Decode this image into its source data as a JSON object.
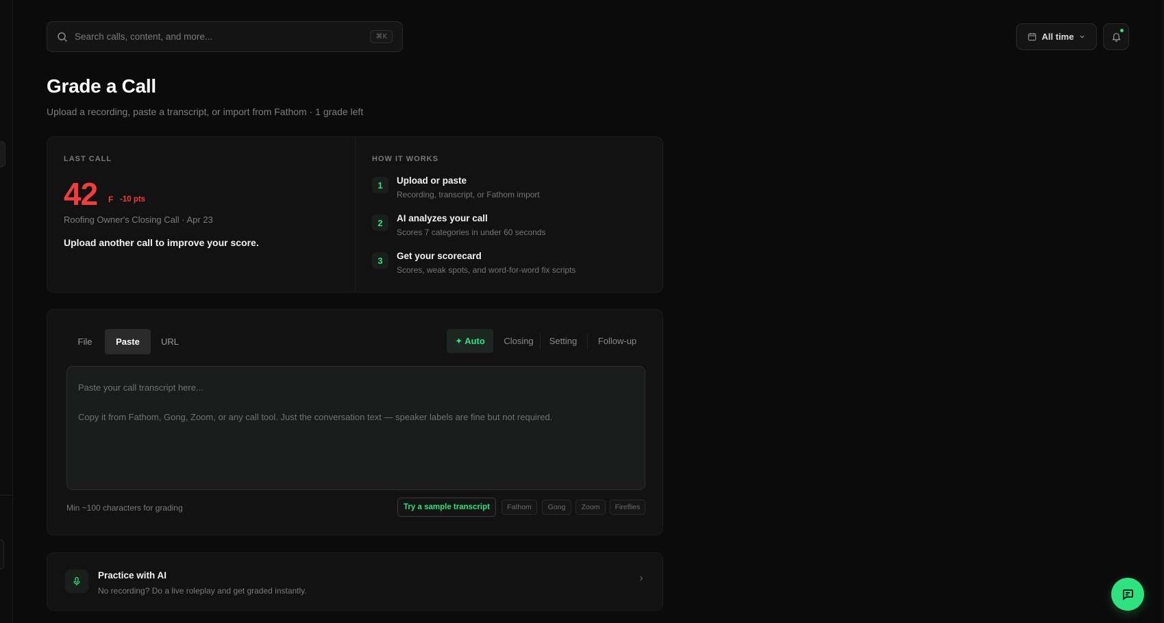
{
  "search": {
    "placeholder": "Search calls, content, and more...",
    "shortcut": "⌘K"
  },
  "header": {
    "time_filter": "All time"
  },
  "page": {
    "title": "Grade a Call",
    "subtitle": "Upload a recording, paste a transcript, or import from Fathom · 1 grade left"
  },
  "last_call": {
    "label": "LAST CALL",
    "score": "42",
    "grade": "F",
    "delta": "-10 pts",
    "meta": "Roofing Owner's Closing Call · Apr 23",
    "cta": "Upload another call to improve your score."
  },
  "how_it_works": {
    "label": "HOW IT WORKS",
    "steps": [
      {
        "num": "1",
        "title": "Upload or paste",
        "desc": "Recording, transcript, or Fathom import"
      },
      {
        "num": "2",
        "title": "AI analyzes your call",
        "desc": "Scores 7 categories in under 60 seconds"
      },
      {
        "num": "3",
        "title": "Get your scorecard",
        "desc": "Scores, weak spots, and word-for-word fix scripts"
      }
    ]
  },
  "input": {
    "tabs": [
      "File",
      "Paste",
      "URL"
    ],
    "active_tab": "Paste",
    "modes": [
      "✦ Auto",
      "Closing",
      "Setting",
      "Follow-up"
    ],
    "active_mode": "✦ Auto",
    "transcript_placeholder": "Paste your call transcript here...\n\nCopy it from Fathom, Gong, Zoom, or any call tool. Just the conversation text — speaker labels are fine but not required.",
    "min_note": "Min ~100 characters for grading",
    "sample_button": "Try a sample transcript",
    "sources": [
      "Fathom",
      "Gong",
      "Zoom",
      "Fireflies"
    ]
  },
  "practice": {
    "title": "Practice with AI",
    "desc": "No recording? Do a live roleplay and get graded instantly."
  },
  "colors": {
    "accent": "#2ee37f",
    "danger": "#f03e3e",
    "background": "#0b0b0b"
  }
}
